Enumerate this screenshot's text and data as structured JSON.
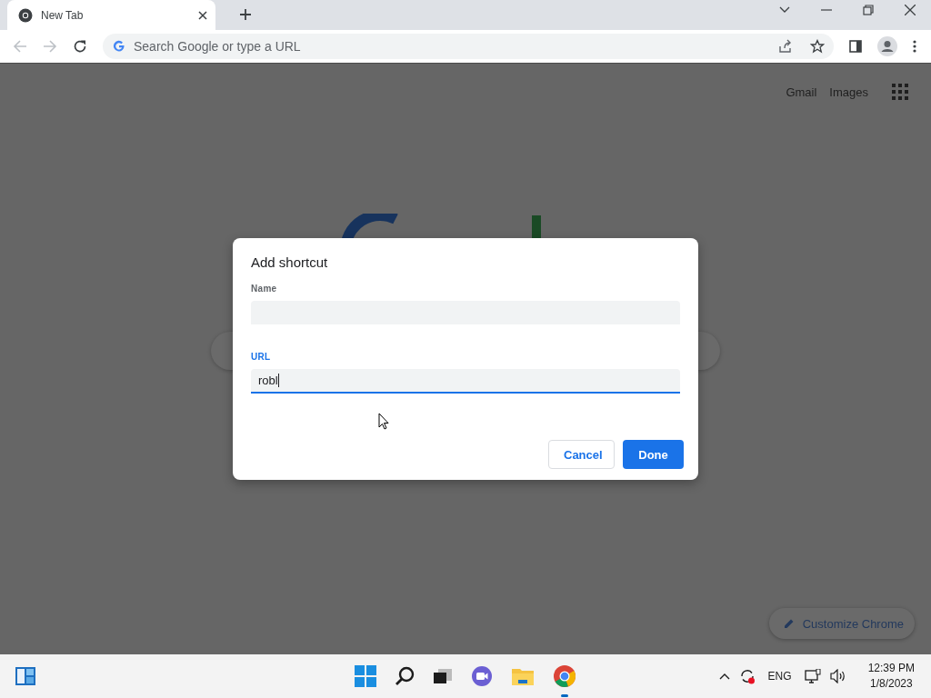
{
  "tab": {
    "title": "New Tab"
  },
  "address_bar": {
    "placeholder": "Search Google or type a URL"
  },
  "top_links": [
    "Gmail",
    "Images"
  ],
  "dialog": {
    "title": "Add shortcut",
    "fields": [
      {
        "label": "Name",
        "focused": false
      },
      {
        "label": "URL",
        "value": "robl",
        "focused": true
      }
    ],
    "buttons": [
      {
        "label": "Cancel",
        "kind": "secondary"
      },
      {
        "label": "Done",
        "kind": "primary"
      }
    ]
  },
  "customize_button": "Customize Chrome",
  "taskbar": {
    "language": "ENG",
    "time": "12:39 PM",
    "date": "1/8/2023"
  }
}
